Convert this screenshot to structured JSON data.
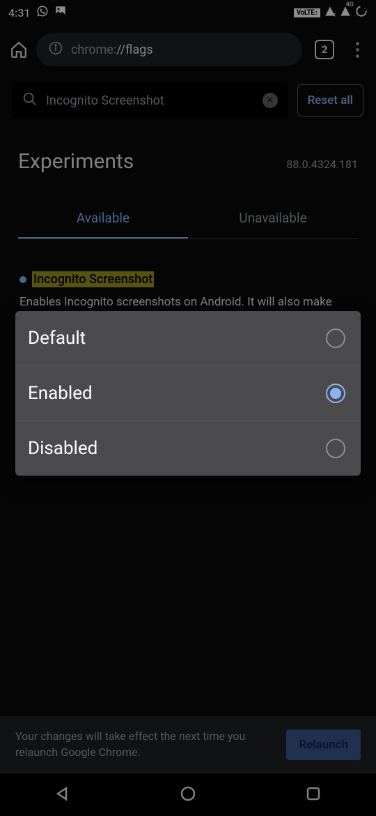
{
  "status": {
    "time": "4:31",
    "volte": "VoLTE↕",
    "signal_label": "4G"
  },
  "toolbar": {
    "url_prefix": "chrome:",
    "url_path": "//flags",
    "tab_count": "2"
  },
  "search": {
    "value": "Incognito Screenshot",
    "reset_label": "Reset all"
  },
  "header": {
    "title": "Experiments",
    "version": "88.0.4324.181"
  },
  "tabs": {
    "available": "Available",
    "unavailable": "Unavailable"
  },
  "flag": {
    "title": "Incognito Screenshot",
    "description": "Enables Incognito screenshots on Android. It will also make Incognito thumbnails visible. – Android"
  },
  "popup": {
    "options": [
      "Default",
      "Enabled",
      "Disabled"
    ],
    "selected_index": 1
  },
  "relaunch": {
    "message": "Your changes will take effect the next time you relaunch Google Chrome.",
    "button": "Relaunch"
  }
}
